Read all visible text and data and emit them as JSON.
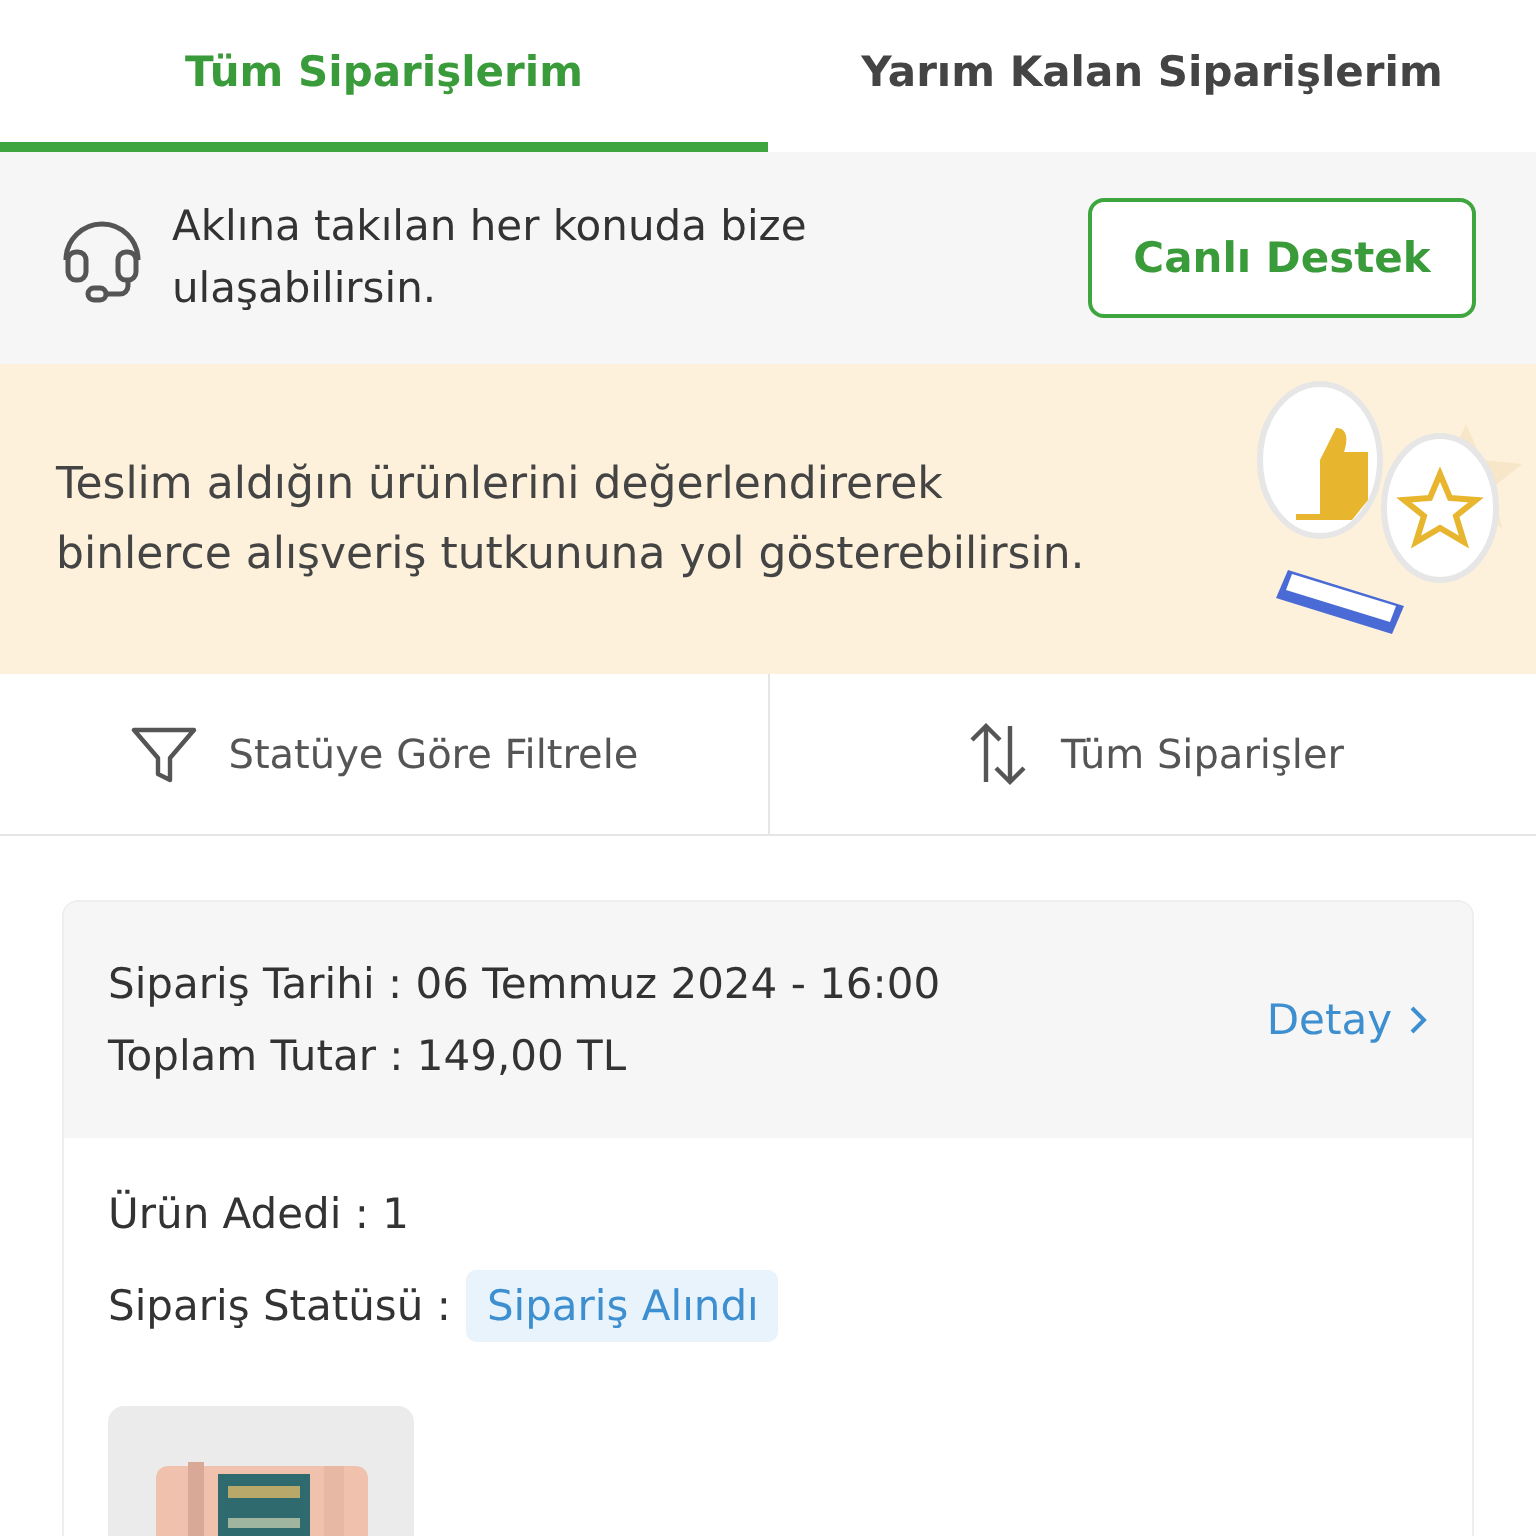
{
  "tabs": [
    {
      "label": "Tüm Siparişlerim",
      "selected": true
    },
    {
      "label": "Yarım Kalan Siparişlerim",
      "selected": false
    }
  ],
  "support": {
    "text": "Aklına takılan her konuda bize ulaşabilirsin.",
    "button": "Canlı Destek"
  },
  "banner": {
    "text": "Teslim aldığın ürünlerini değerlendirerek binlerce alışveriş tutkununa yol gösterebilirsin."
  },
  "filters": [
    {
      "kind": "filter",
      "label": "Statüye Göre Filtrele"
    },
    {
      "kind": "sort",
      "label": "Tüm Siparişler"
    }
  ],
  "order": {
    "date": "Sipariş Tarihi : 06 Temmuz 2024 - 16:00",
    "total": "Toplam Tutar : 149,00 TL",
    "detail_link": "Detay",
    "count": "Ürün Adedi : 1",
    "status_label": "Sipariş Statüsü :",
    "status": "Sipariş Alındı"
  }
}
